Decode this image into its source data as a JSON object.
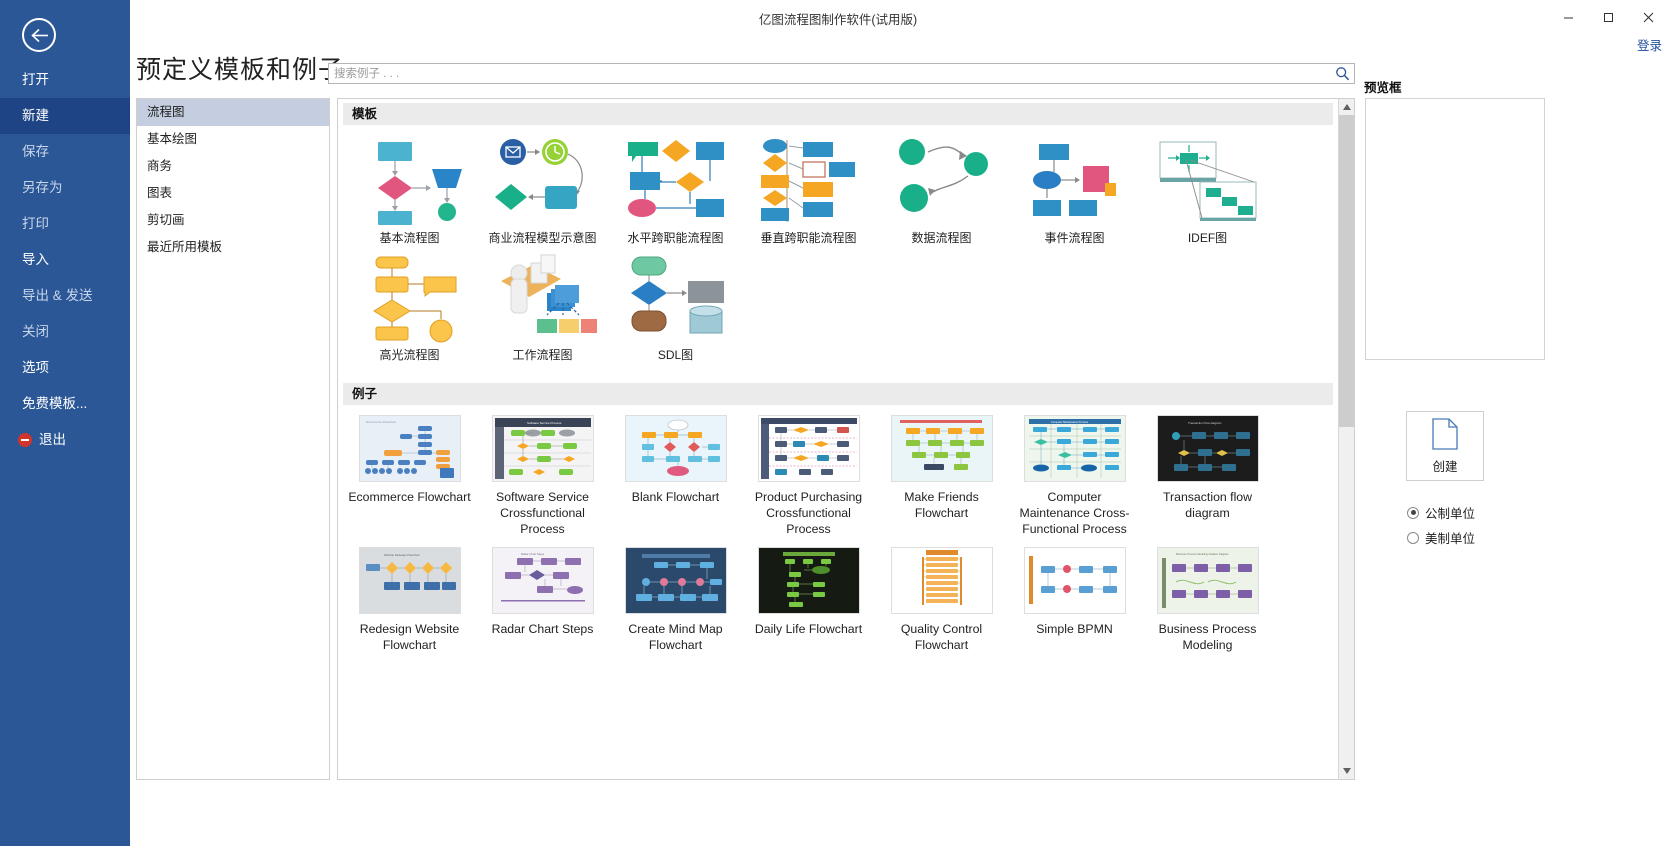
{
  "window": {
    "title": "亿图流程图制作软件(试用版)",
    "minimize": "minimize-icon",
    "maximize": "maximize-icon",
    "close": "close-icon"
  },
  "header": {
    "page_title": "预定义模板和例子",
    "login_label": "登录"
  },
  "search": {
    "placeholder": "搜索例子 . . .",
    "value": "",
    "icon": "search-icon"
  },
  "sidebar": {
    "back_icon": "back-arrow-icon",
    "items": [
      {
        "label": "打开",
        "state": "enabled",
        "active": false
      },
      {
        "label": "新建",
        "state": "enabled",
        "active": true
      },
      {
        "label": "保存",
        "state": "disabled",
        "active": false
      },
      {
        "label": "另存为",
        "state": "disabled",
        "active": false
      },
      {
        "label": "打印",
        "state": "disabled",
        "active": false
      },
      {
        "label": "导入",
        "state": "enabled",
        "active": false
      },
      {
        "label": "导出 & 发送",
        "state": "disabled",
        "active": false
      },
      {
        "label": "关闭",
        "state": "disabled",
        "active": false
      },
      {
        "label": "选项",
        "state": "enabled",
        "active": false
      },
      {
        "label": "免费模板...",
        "state": "enabled",
        "active": false
      },
      {
        "label": "退出",
        "state": "enabled",
        "active": false,
        "icon": "exit-icon"
      }
    ]
  },
  "categories": {
    "items": [
      {
        "label": "流程图",
        "selected": true
      },
      {
        "label": "基本绘图",
        "selected": false
      },
      {
        "label": "商务",
        "selected": false
      },
      {
        "label": "图表",
        "selected": false
      },
      {
        "label": "剪切画",
        "selected": false
      },
      {
        "label": "最近所用模板",
        "selected": false
      }
    ]
  },
  "templates_section": {
    "heading": "模板",
    "items": [
      {
        "label": "基本流程图",
        "thumb": "basic-flowchart-thumb"
      },
      {
        "label": "商业流程模型示意图",
        "thumb": "bpmn-thumb"
      },
      {
        "label": "水平跨职能流程图",
        "thumb": "horizontal-crossfunctional-thumb"
      },
      {
        "label": "垂直跨职能流程图",
        "thumb": "vertical-crossfunctional-thumb"
      },
      {
        "label": "数据流程图",
        "thumb": "dataflow-thumb"
      },
      {
        "label": "事件流程图",
        "thumb": "event-flowchart-thumb"
      },
      {
        "label": "IDEF图",
        "thumb": "idef-thumb"
      },
      {
        "label": "高光流程图",
        "thumb": "highlight-flowchart-thumb"
      },
      {
        "label": "工作流程图",
        "thumb": "workflow-thumb"
      },
      {
        "label": "SDL图",
        "thumb": "sdl-thumb"
      }
    ]
  },
  "examples_section": {
    "heading": "例子",
    "items": [
      {
        "label": "Ecommerce Flowchart",
        "thumb": "ecommerce-flowchart-thumb"
      },
      {
        "label": "Software Service Crossfunctional Process",
        "thumb": "software-service-thumb"
      },
      {
        "label": "Blank Flowchart",
        "thumb": "blank-flowchart-thumb"
      },
      {
        "label": "Product Purchasing Crossfunctional Process",
        "thumb": "product-purchasing-thumb"
      },
      {
        "label": "Make Friends Flowchart",
        "thumb": "make-friends-thumb"
      },
      {
        "label": "Computer Maintenance Cross-Functional Process",
        "thumb": "computer-maintenance-thumb"
      },
      {
        "label": "Transaction flow diagram",
        "thumb": "transaction-flow-thumb"
      },
      {
        "label": "Redesign Website Flowchart",
        "thumb": "redesign-website-thumb"
      },
      {
        "label": "Radar Chart Steps",
        "thumb": "radar-chart-steps-thumb"
      },
      {
        "label": "Create Mind Map Flowchart",
        "thumb": "create-mind-map-thumb"
      },
      {
        "label": "Daily Life Flowchart",
        "thumb": "daily-life-thumb"
      },
      {
        "label": "Quality Control Flowchart",
        "thumb": "quality-control-thumb"
      },
      {
        "label": "Simple BPMN",
        "thumb": "simple-bpmn-thumb"
      },
      {
        "label": "Business Process Modeling",
        "thumb": "business-process-modeling-thumb"
      }
    ]
  },
  "right_panel": {
    "preview_label": "预览框",
    "create_label": "创建",
    "create_icon": "new-document-icon",
    "units": [
      {
        "label": "公制单位",
        "selected": true
      },
      {
        "label": "美制单位",
        "selected": false
      }
    ]
  },
  "colors": {
    "sidebar_bg": "#2b5797",
    "sidebar_active": "#1e4485",
    "category_selected": "#c4cee0",
    "section_header_bg": "#ebebeb",
    "link": "#1f4e9c",
    "teal": "#3aa8c1",
    "orange": "#f5a623",
    "pink": "#e05a8a",
    "green": "#27b88a"
  }
}
